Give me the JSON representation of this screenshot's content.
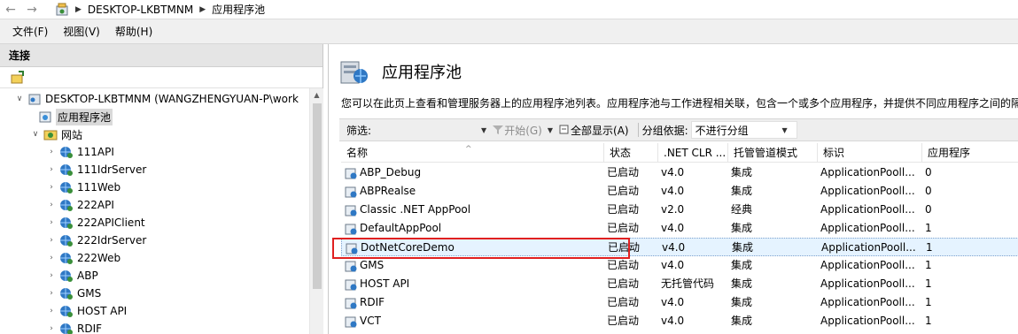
{
  "address": {
    "host": "DESKTOP-LKBTMNM",
    "page": "应用程序池"
  },
  "menu": [
    {
      "label": "文件(F)"
    },
    {
      "label": "视图(V)"
    },
    {
      "label": "帮助(H)"
    }
  ],
  "connections": {
    "header": "连接",
    "server_label": "DESKTOP-LKBTMNM (WANGZHENGYUAN-P\\work",
    "app_pools_label": "应用程序池",
    "sites_label": "网站",
    "sites": [
      "111API",
      "111IdrServer",
      "111Web",
      "222API",
      "222APIClient",
      "222IdrServer",
      "222Web",
      "ABP",
      "GMS",
      "HOST API",
      "RDIF"
    ]
  },
  "main": {
    "title": "应用程序池",
    "description": "您可以在此页上查看和管理服务器上的应用程序池列表。应用程序池与工作进程相关联，包含一个或多个应用程序，并提供不同应用程序之间的隔离。",
    "filter_label": "筛选:",
    "start_label": "开始(G)",
    "show_all_label": "全部显示(A)",
    "group_by_label": "分组依据:",
    "group_by_value": "不进行分组"
  },
  "table": {
    "columns": [
      "名称",
      "状态",
      ".NET CLR ...",
      "托管管道模式",
      "标识",
      "应用程序"
    ],
    "rows": [
      {
        "name": "ABP_Debug",
        "status": "已启动",
        "clr": "v4.0",
        "pipeline": "集成",
        "identity": "ApplicationPooll...",
        "apps": "0"
      },
      {
        "name": "ABPRealse",
        "status": "已启动",
        "clr": "v4.0",
        "pipeline": "集成",
        "identity": "ApplicationPooll...",
        "apps": "0"
      },
      {
        "name": "Classic .NET AppPool",
        "status": "已启动",
        "clr": "v2.0",
        "pipeline": "经典",
        "identity": "ApplicationPooll...",
        "apps": "0"
      },
      {
        "name": "DefaultAppPool",
        "status": "已启动",
        "clr": "v4.0",
        "pipeline": "集成",
        "identity": "ApplicationPooll...",
        "apps": "1"
      },
      {
        "name": "DotNetCoreDemo",
        "status": "已启动",
        "clr": "v4.0",
        "pipeline": "集成",
        "identity": "ApplicationPooll...",
        "apps": "1"
      },
      {
        "name": "GMS",
        "status": "已启动",
        "clr": "v4.0",
        "pipeline": "集成",
        "identity": "ApplicationPooll...",
        "apps": "1"
      },
      {
        "name": "HOST API",
        "status": "已启动",
        "clr": "无托管代码",
        "pipeline": "集成",
        "identity": "ApplicationPooll...",
        "apps": "1"
      },
      {
        "name": "RDIF",
        "status": "已启动",
        "clr": "v4.0",
        "pipeline": "集成",
        "identity": "ApplicationPooll...",
        "apps": "1"
      },
      {
        "name": "VCT",
        "status": "已启动",
        "clr": "v4.0",
        "pipeline": "集成",
        "identity": "ApplicationPooll...",
        "apps": "1"
      }
    ],
    "selected_index": 4
  },
  "colors": {
    "highlight": "#e02020",
    "selection": "#e5f3ff"
  }
}
